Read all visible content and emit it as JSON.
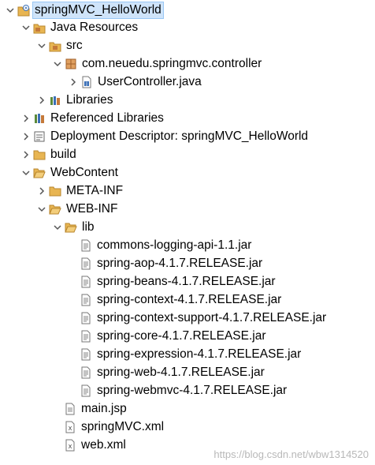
{
  "tree": [
    {
      "label": "springMVC_HelloWorld",
      "icon": "project-icon",
      "twisty": "expanded",
      "selected": true
    },
    {
      "label": "Java Resources",
      "icon": "java-resources-icon",
      "twisty": "expanded"
    },
    {
      "label": "src",
      "icon": "source-folder-icon",
      "twisty": "expanded"
    },
    {
      "label": "com.neuedu.springmvc.controller",
      "icon": "package-icon",
      "twisty": "expanded"
    },
    {
      "label": "UserController.java",
      "icon": "java-file-icon",
      "twisty": "collapsed"
    },
    {
      "label": "Libraries",
      "icon": "libraries-icon",
      "twisty": "collapsed"
    },
    {
      "label": "Referenced Libraries",
      "icon": "referenced-libraries-icon",
      "twisty": "collapsed"
    },
    {
      "label": "Deployment Descriptor: springMVC_HelloWorld",
      "icon": "deployment-descriptor-icon",
      "twisty": "collapsed"
    },
    {
      "label": "build",
      "icon": "folder-icon",
      "twisty": "collapsed"
    },
    {
      "label": "WebContent",
      "icon": "folder-open-icon",
      "twisty": "expanded"
    },
    {
      "label": "META-INF",
      "icon": "folder-icon",
      "twisty": "collapsed"
    },
    {
      "label": "WEB-INF",
      "icon": "folder-open-icon",
      "twisty": "expanded"
    },
    {
      "label": "lib",
      "icon": "folder-open-icon",
      "twisty": "expanded"
    },
    {
      "label": "commons-logging-api-1.1.jar",
      "icon": "jar-file-icon",
      "twisty": "none"
    },
    {
      "label": "spring-aop-4.1.7.RELEASE.jar",
      "icon": "jar-file-icon",
      "twisty": "none"
    },
    {
      "label": "spring-beans-4.1.7.RELEASE.jar",
      "icon": "jar-file-icon",
      "twisty": "none"
    },
    {
      "label": "spring-context-4.1.7.RELEASE.jar",
      "icon": "jar-file-icon",
      "twisty": "none"
    },
    {
      "label": "spring-context-support-4.1.7.RELEASE.jar",
      "icon": "jar-file-icon",
      "twisty": "none"
    },
    {
      "label": "spring-core-4.1.7.RELEASE.jar",
      "icon": "jar-file-icon",
      "twisty": "none"
    },
    {
      "label": "spring-expression-4.1.7.RELEASE.jar",
      "icon": "jar-file-icon",
      "twisty": "none"
    },
    {
      "label": "spring-web-4.1.7.RELEASE.jar",
      "icon": "jar-file-icon",
      "twisty": "none"
    },
    {
      "label": "spring-webmvc-4.1.7.RELEASE.jar",
      "icon": "jar-file-icon",
      "twisty": "none"
    },
    {
      "label": "main.jsp",
      "icon": "jsp-file-icon",
      "twisty": "none"
    },
    {
      "label": "springMVC.xml",
      "icon": "xml-file-icon",
      "twisty": "none"
    },
    {
      "label": "web.xml",
      "icon": "xml-file-icon",
      "twisty": "none"
    }
  ],
  "watermark": "https://blog.csdn.net/wbw1314520",
  "colors": {
    "folder": "#e8b552",
    "selection": "#cfe4fa",
    "package": "#c4793a",
    "java": "#3b6fb6",
    "twisty": "#555555"
  }
}
